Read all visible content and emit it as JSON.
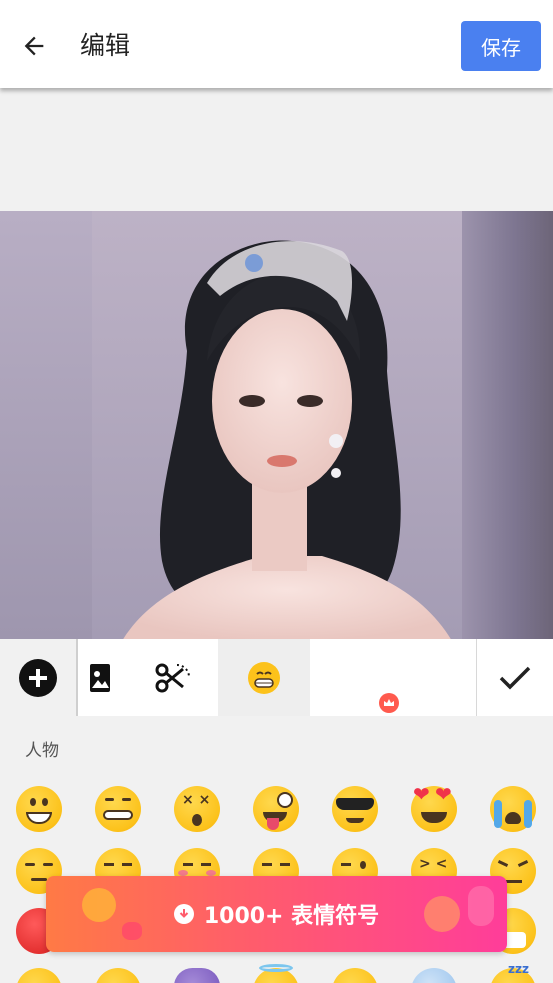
{
  "header": {
    "title": "编辑",
    "save_label": "保存"
  },
  "toolbar": {
    "tools": [
      "add",
      "image",
      "cut",
      "emoji",
      "vip",
      "done"
    ],
    "selected": "emoji"
  },
  "emoji_panel": {
    "category": "人物",
    "promo_label": "1000+ 表情符号"
  },
  "colors": {
    "accent": "#4a80f0",
    "promo_start": "#ff7a45",
    "promo_end": "#ff3d9a"
  }
}
